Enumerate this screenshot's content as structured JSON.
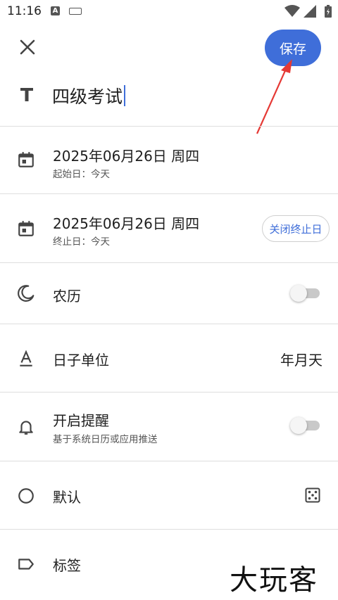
{
  "status_bar": {
    "time": "11:16",
    "icon_a_glyph": "A"
  },
  "toolbar": {
    "close_icon": "close-icon",
    "save_label": "保存"
  },
  "title": {
    "value": "四级考试"
  },
  "start_date": {
    "date": "2025年06月26日 周四",
    "sub": "起始日：今天"
  },
  "end_date": {
    "date": "2025年06月26日 周四",
    "sub": "终止日：今天",
    "chip_label": "关闭终止日"
  },
  "lunar": {
    "label": "农历",
    "enabled": false
  },
  "day_unit": {
    "label": "日子单位",
    "value": "年月天"
  },
  "reminder": {
    "label": "开启提醒",
    "sub": "基于系统日历或应用推送",
    "enabled": false
  },
  "default_item": {
    "label": "默认"
  },
  "tags": {
    "label": "标签"
  },
  "watermark": "大玩客",
  "colors": {
    "accent": "#3f6ed9",
    "arrow": "#e53935"
  }
}
